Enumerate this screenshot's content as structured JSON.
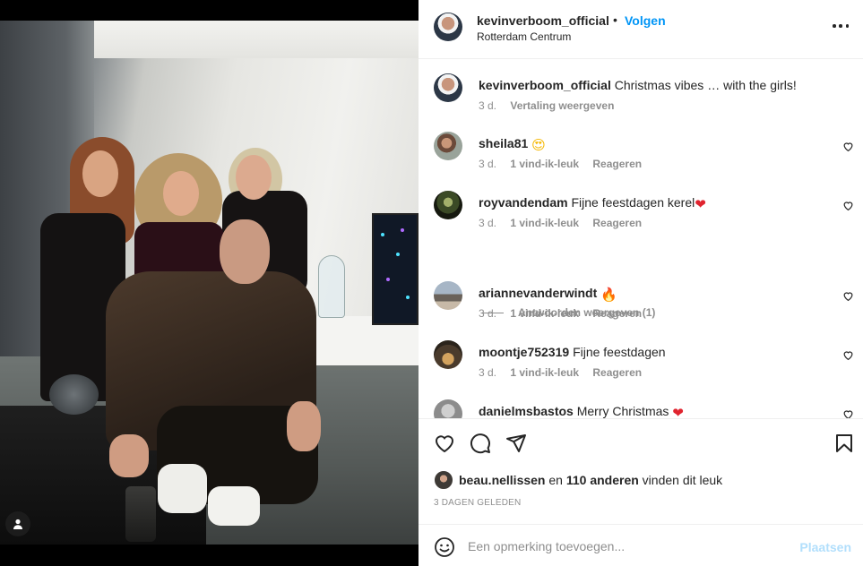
{
  "header": {
    "username": "kevinverboom_official",
    "separator": "•",
    "follow_label": "Volgen",
    "location": "Rotterdam Centrum"
  },
  "caption": {
    "username": "kevinverboom_official",
    "text": "Christmas vibes … with the girls!",
    "time": "3 d.",
    "translate_label": "Vertaling weergeven"
  },
  "comments": [
    {
      "username": "sheila81",
      "text": "",
      "emoji": "😍",
      "time": "3 d.",
      "likes": "1 vind-ik-leuk",
      "reply": "Reageren"
    },
    {
      "username": "royvandendam",
      "text": "Fijne feestdagen kerel",
      "emoji": "❤",
      "time": "3 d.",
      "likes": "1 vind-ik-leuk",
      "reply": "Reageren"
    },
    {
      "username": "ariannevanderwindt",
      "text": "",
      "emoji": "🔥",
      "time": "3 d.",
      "likes": "1 vind-ik-leuk",
      "reply": "Reageren"
    },
    {
      "username": "moontje752319",
      "text": "Fijne feestdagen",
      "emoji": "",
      "time": "3 d.",
      "likes": "1 vind-ik-leuk",
      "reply": "Reageren"
    },
    {
      "username": "danielmsbastos",
      "text": "Merry Christmas",
      "emoji": "❤",
      "time": "",
      "likes": "",
      "reply": ""
    }
  ],
  "view_replies": "Antwoorden weergeven (1)",
  "likes": {
    "user": "beau.nellissen",
    "middle": "en",
    "count": "110 anderen",
    "suffix": "vinden dit leuk"
  },
  "posted_date": "3 DAGEN GELEDEN",
  "add_comment": {
    "placeholder": "Een opmerking toevoegen...",
    "post_label": "Plaatsen"
  },
  "icons": {
    "tag": "person-tag-icon",
    "more": "more-options-icon",
    "like": "heart-icon",
    "comment": "comment-icon",
    "share": "share-icon",
    "save": "bookmark-icon",
    "emoji": "emoji-icon"
  },
  "colors": {
    "accent": "#0095f6",
    "post_disabled": "#b2dffc",
    "muted": "#8e8e8e",
    "text": "#262626",
    "heart": "#e0242f"
  }
}
